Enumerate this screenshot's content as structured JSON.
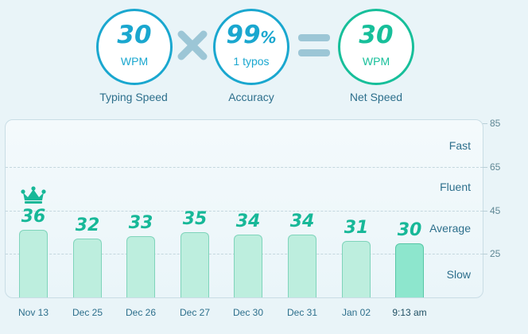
{
  "summary": {
    "typing_speed": {
      "value": "30",
      "unit": "WPM",
      "label": "Typing Speed"
    },
    "accuracy": {
      "value": "99",
      "suffix": "%",
      "unit": "1 typos",
      "label": "Accuracy"
    },
    "net_speed": {
      "value": "30",
      "unit": "WPM",
      "label": "Net Speed"
    },
    "operators": [
      "times-icon",
      "equals-icon"
    ]
  },
  "chart": {
    "bands": [
      "Fast",
      "Fluent",
      "Average",
      "Slow"
    ],
    "colors": {
      "bar": "#bdeede",
      "bar_current": "#8de6cd",
      "value_text": "#17b898",
      "accent_blue": "#1aa7cf",
      "accent_green": "#17bf9a"
    },
    "best_marker": "crown-icon"
  },
  "chart_data": {
    "type": "bar",
    "categories": [
      "Nov 13",
      "Dec 25",
      "Dec 26",
      "Dec 27",
      "Dec 30",
      "Dec 31",
      "Jan 02",
      "9:13 am"
    ],
    "values": [
      36,
      32,
      33,
      35,
      34,
      34,
      31,
      30
    ],
    "value_labels": [
      "36",
      "32",
      "33",
      "35",
      "34",
      "34",
      "31",
      "30"
    ],
    "yticks": [
      "85",
      "65",
      "45",
      "25"
    ],
    "ylim": [
      5,
      85
    ],
    "grid": true,
    "highlighted_index": 7,
    "best_index": 0
  }
}
